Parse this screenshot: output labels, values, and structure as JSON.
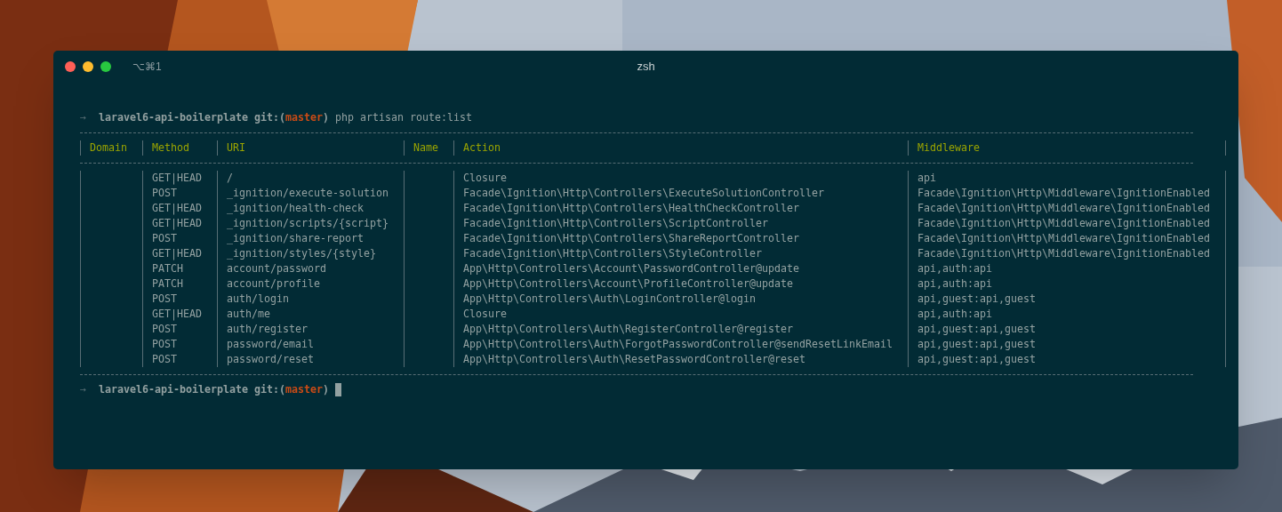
{
  "window": {
    "title": "zsh",
    "shortcut": "⌥⌘1"
  },
  "prompt": {
    "arrow": "→",
    "directory": "laravel6-api-boilerplate",
    "git_open": "git:(",
    "branch": "master",
    "git_close": ")",
    "command": "php artisan route:list"
  },
  "table": {
    "columns": [
      "Domain",
      "Method",
      "URI",
      "Name",
      "Action",
      "Middleware"
    ],
    "rows": [
      {
        "method": "GET|HEAD",
        "uri": "/",
        "action": "Closure",
        "middleware": "api"
      },
      {
        "method": "POST",
        "uri": "_ignition/execute-solution",
        "action": "Facade\\Ignition\\Http\\Controllers\\ExecuteSolutionController",
        "middleware": "Facade\\Ignition\\Http\\Middleware\\IgnitionEnabled"
      },
      {
        "method": "GET|HEAD",
        "uri": "_ignition/health-check",
        "action": "Facade\\Ignition\\Http\\Controllers\\HealthCheckController",
        "middleware": "Facade\\Ignition\\Http\\Middleware\\IgnitionEnabled"
      },
      {
        "method": "GET|HEAD",
        "uri": "_ignition/scripts/{script}",
        "action": "Facade\\Ignition\\Http\\Controllers\\ScriptController",
        "middleware": "Facade\\Ignition\\Http\\Middleware\\IgnitionEnabled"
      },
      {
        "method": "POST",
        "uri": "_ignition/share-report",
        "action": "Facade\\Ignition\\Http\\Controllers\\ShareReportController",
        "middleware": "Facade\\Ignition\\Http\\Middleware\\IgnitionEnabled"
      },
      {
        "method": "GET|HEAD",
        "uri": "_ignition/styles/{style}",
        "action": "Facade\\Ignition\\Http\\Controllers\\StyleController",
        "middleware": "Facade\\Ignition\\Http\\Middleware\\IgnitionEnabled"
      },
      {
        "method": "PATCH",
        "uri": "account/password",
        "action": "App\\Http\\Controllers\\Account\\PasswordController@update",
        "middleware": "api,auth:api"
      },
      {
        "method": "PATCH",
        "uri": "account/profile",
        "action": "App\\Http\\Controllers\\Account\\ProfileController@update",
        "middleware": "api,auth:api"
      },
      {
        "method": "POST",
        "uri": "auth/login",
        "action": "App\\Http\\Controllers\\Auth\\LoginController@login",
        "middleware": "api,guest:api,guest"
      },
      {
        "method": "GET|HEAD",
        "uri": "auth/me",
        "action": "Closure",
        "middleware": "api,auth:api"
      },
      {
        "method": "POST",
        "uri": "auth/register",
        "action": "App\\Http\\Controllers\\Auth\\RegisterController@register",
        "middleware": "api,guest:api,guest"
      },
      {
        "method": "POST",
        "uri": "password/email",
        "action": "App\\Http\\Controllers\\Auth\\ForgotPasswordController@sendResetLinkEmail",
        "middleware": "api,guest:api,guest"
      },
      {
        "method": "POST",
        "uri": "password/reset",
        "action": "App\\Http\\Controllers\\Auth\\ResetPasswordController@reset",
        "middleware": "api,guest:api,guest"
      }
    ]
  },
  "final_prompt": {
    "arrow": "→",
    "directory": "laravel6-api-boilerplate",
    "git_open": "git:(",
    "branch": "master",
    "git_close": ")",
    "cursor": true
  }
}
